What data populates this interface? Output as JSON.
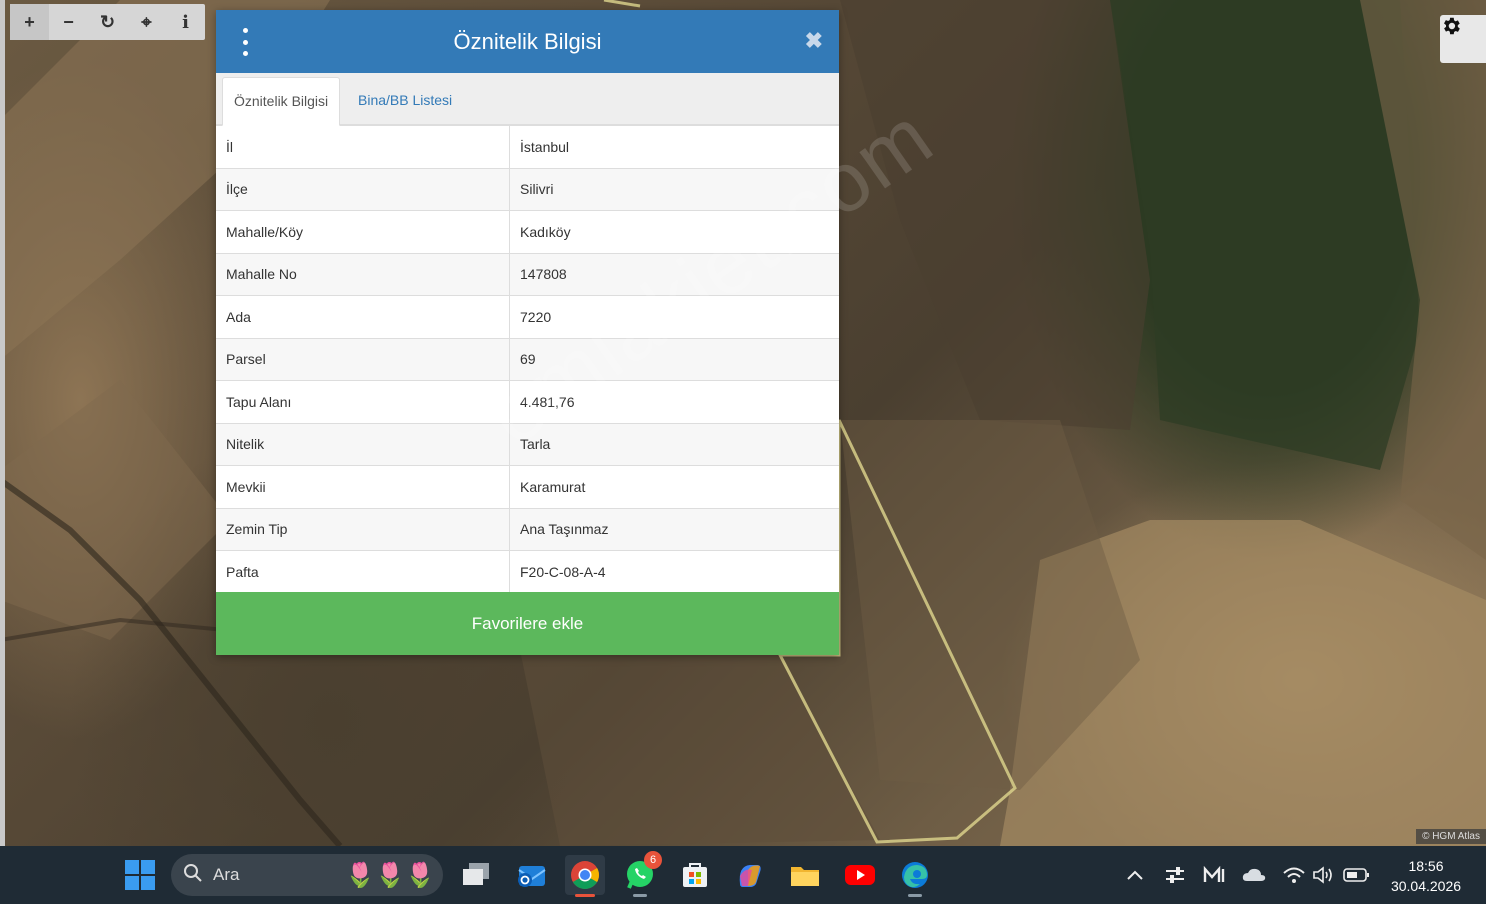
{
  "map": {
    "toolbar": [
      {
        "icon": "plus-icon",
        "glyph": "+"
      },
      {
        "icon": "minus-icon",
        "glyph": "−"
      },
      {
        "icon": "refresh-icon",
        "glyph": "↻"
      },
      {
        "icon": "crosshair-icon",
        "glyph": "⌖"
      },
      {
        "icon": "info-icon",
        "glyph": "i"
      }
    ],
    "settings_icon": "gear-icon",
    "attribution": "© HGM Atlas",
    "watermark": "emlakjet.com"
  },
  "dialog": {
    "title": "Öznitelik Bilgisi",
    "menu_icon": "vertical-dots-icon",
    "close_glyph": "✖",
    "tabs": [
      {
        "label": "Öznitelik Bilgisi",
        "active": true
      },
      {
        "label": "Bina/BB Listesi",
        "active": false
      }
    ],
    "rows": [
      {
        "key": "İl",
        "value": "İstanbul"
      },
      {
        "key": "İlçe",
        "value": "Silivri"
      },
      {
        "key": "Mahalle/Köy",
        "value": "Kadıköy"
      },
      {
        "key": "Mahalle No",
        "value": "147808"
      },
      {
        "key": "Ada",
        "value": "7220"
      },
      {
        "key": "Parsel",
        "value": "69"
      },
      {
        "key": "Tapu Alanı",
        "value": "4.481,76"
      },
      {
        "key": "Nitelik",
        "value": "Tarla"
      },
      {
        "key": "Mevkii",
        "value": "Karamurat"
      },
      {
        "key": "Zemin Tip",
        "value": "Ana Taşınmaz"
      },
      {
        "key": "Pafta",
        "value": "F20-C-08-A-4"
      }
    ],
    "favorite_button": "Favorilere ekle",
    "colors": {
      "header": "#337ab7",
      "button": "#5cb85c"
    }
  },
  "taskbar": {
    "search_placeholder": "Ara",
    "whatsapp_badge": "6",
    "apps": [
      "start-icon",
      "task-view-icon",
      "outlook-icon",
      "chrome-icon",
      "whatsapp-icon",
      "store-icon",
      "copilot-icon",
      "file-explorer-icon",
      "youtube-icon",
      "edge-icon"
    ],
    "tray": [
      "chevron-up-icon",
      "switch-icon",
      "app-icon",
      "cloud-icon",
      "wifi-icon",
      "volume-icon",
      "battery-icon"
    ],
    "time": "18:56",
    "date": "30.04.2026"
  }
}
